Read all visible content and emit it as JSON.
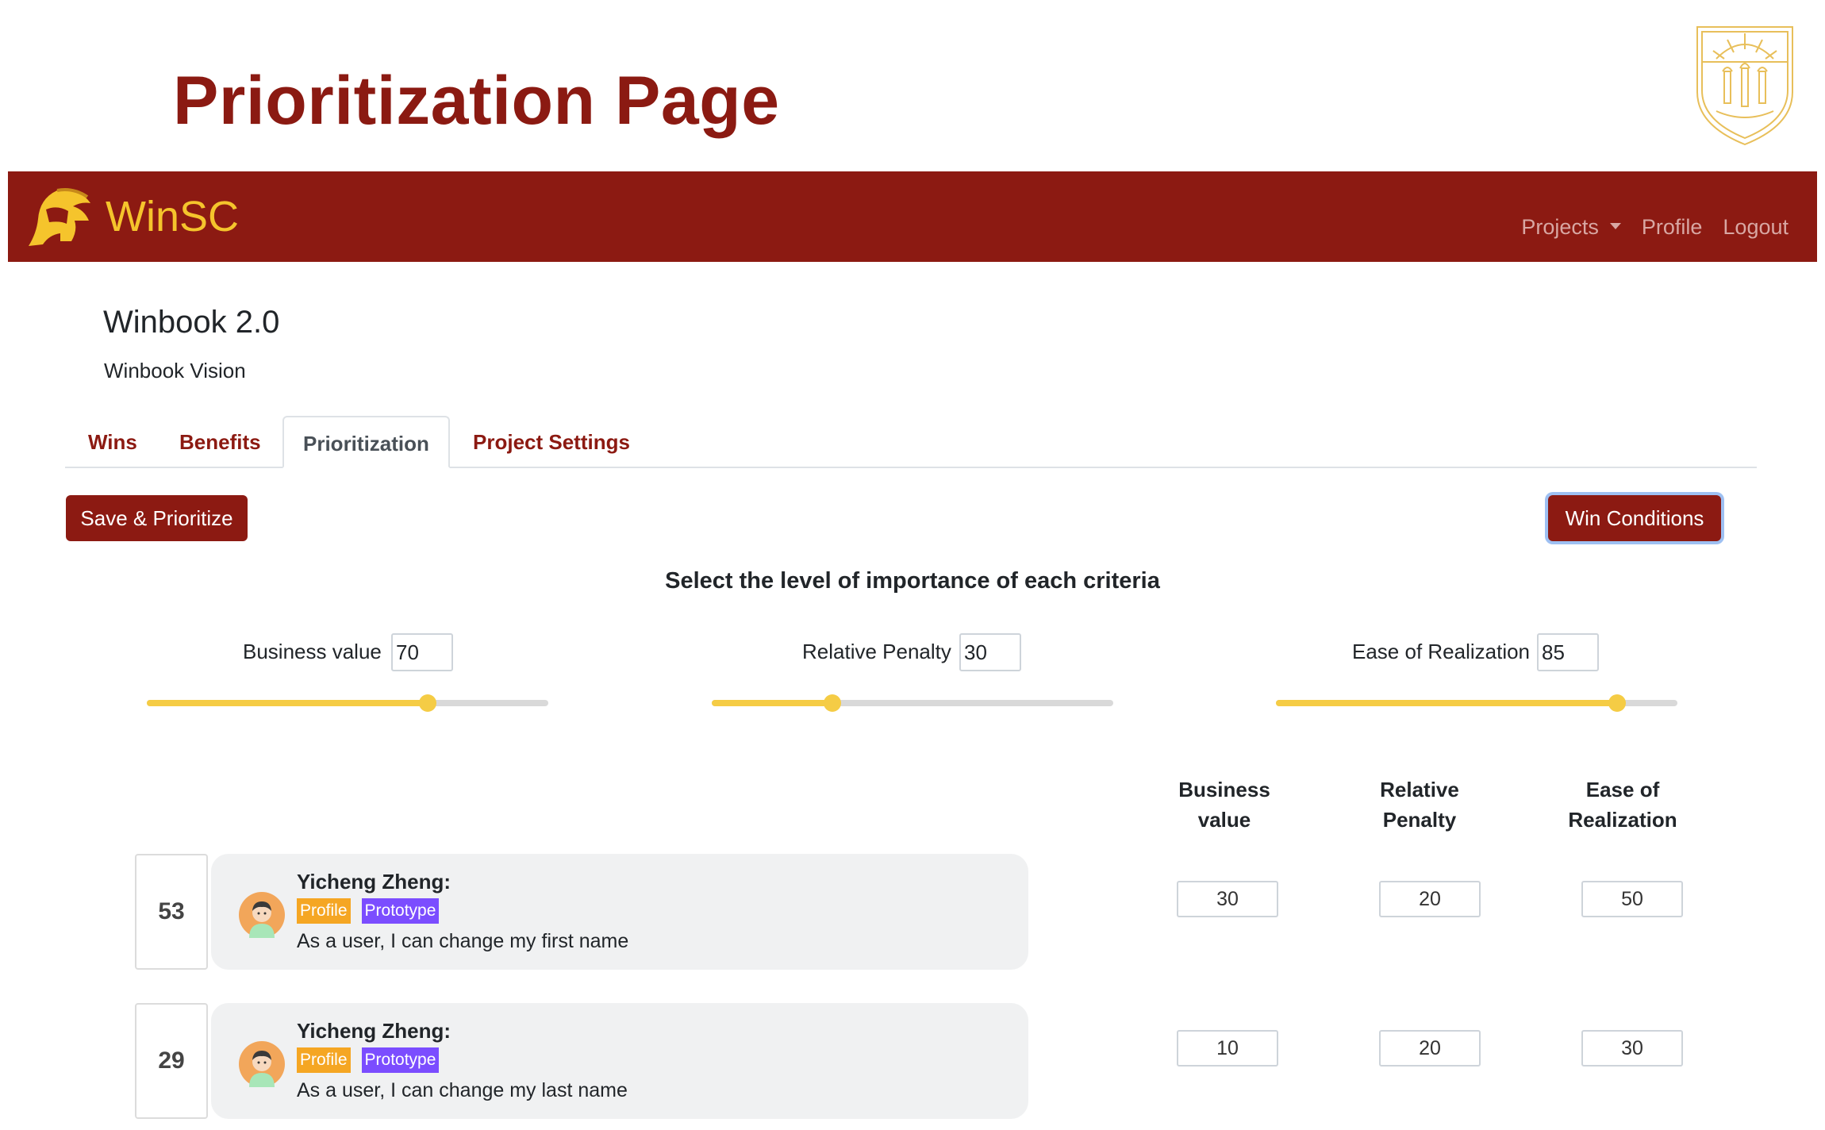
{
  "slide": {
    "title": "Prioritization Page"
  },
  "navbar": {
    "brand": "WinSC",
    "links": {
      "projects": "Projects",
      "profile": "Profile",
      "logout": "Logout"
    }
  },
  "project": {
    "title": "Winbook 2.0",
    "vision": "Winbook Vision"
  },
  "tabs": [
    {
      "label": "Wins"
    },
    {
      "label": "Benefits"
    },
    {
      "label": "Prioritization",
      "active": true
    },
    {
      "label": "Project Settings"
    }
  ],
  "actions": {
    "save_label": "Save & Prioritize",
    "win_conditions_label": "Win Conditions"
  },
  "criteria": {
    "heading": "Select the level of importance of each criteria",
    "items": [
      {
        "label": "Business value",
        "value": "70"
      },
      {
        "label": "Relative Penalty",
        "value": "30"
      },
      {
        "label": "Ease of Realization",
        "value": "85"
      }
    ]
  },
  "columns": [
    {
      "line1": "Business",
      "line2": "value"
    },
    {
      "line1": "Relative",
      "line2": "Penalty"
    },
    {
      "line1": "Ease of",
      "line2": "Realization"
    }
  ],
  "stories": [
    {
      "rank": "53",
      "author": "Yicheng Zheng:",
      "badges": [
        "Profile",
        "Prototype"
      ],
      "text": "As a user, I can change my first name",
      "business_value": "30",
      "relative_penalty": "20",
      "ease_of_realization": "50"
    },
    {
      "rank": "29",
      "author": "Yicheng Zheng:",
      "badges": [
        "Profile",
        "Prototype"
      ],
      "text": "As a user, I can change my last name",
      "business_value": "10",
      "relative_penalty": "20",
      "ease_of_realization": "30"
    }
  ],
  "colors": {
    "brand_red": "#8c1a12",
    "title_red": "#8b1a12",
    "gold": "#f5c42c",
    "slider_fill": "#f5cc45",
    "badge_profile": "#f5a623",
    "badge_prototype": "#7b4dff"
  },
  "icons": {
    "seal": "university-seal-icon",
    "logo": "trojan-helmet-icon",
    "avatar": "user-avatar-icon",
    "dropdown": "caret-down-icon"
  }
}
